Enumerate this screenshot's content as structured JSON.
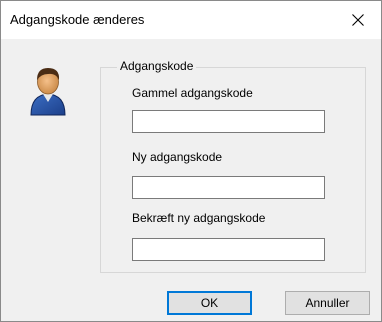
{
  "window": {
    "title": "Adgangskode ænderes"
  },
  "titlebar": {
    "close_icon": "close-icon"
  },
  "avatar_icon": "user-icon",
  "group": {
    "legend": "Adgangskode",
    "fields": {
      "old": {
        "label": "Gammel adgangskode",
        "value": ""
      },
      "new": {
        "label": "Ny adgangskode",
        "value": ""
      },
      "confirm": {
        "label": "Bekræft ny adgangskode",
        "value": ""
      }
    }
  },
  "buttons": {
    "ok": "OK",
    "cancel": "Annuller"
  },
  "colors": {
    "accent": "#0078d7",
    "background": "#f0f0f0",
    "titlebar": "#ffffff"
  }
}
